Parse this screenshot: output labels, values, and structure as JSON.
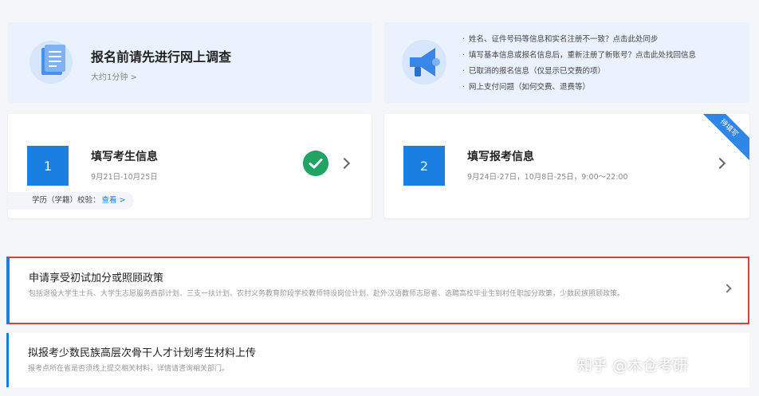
{
  "survey": {
    "title": "报名前请先进行网上调查",
    "subtitle": "大约1分钟 >"
  },
  "notice": {
    "items": [
      "姓名、证件号码等信息和实名注册不一致？点击此处同步",
      "填写基本信息或报名信息后，重新注册了新账号？点击此处找回信息",
      "已取消的报名信息（仅显示已交费的项）",
      "网上支付问题（如何交费、退费等）"
    ]
  },
  "step1": {
    "number": "1",
    "title": "填写考生信息",
    "date": "9月21日-10月25日",
    "verify_label": "学历（学籍）校验：",
    "verify_link": "查看 >"
  },
  "step2": {
    "number": "2",
    "title": "填写报考信息",
    "date": "9月24日-27日，10月8日-25日，9:00～22:00",
    "ribbon": "待填写"
  },
  "policy": {
    "title": "申请享受初试加分或照顾政策",
    "desc": "包括退役大学生士兵、大学生志愿服务西部计划、三支一扶计划、农村义务教育阶段学校教师特设岗位计划、赴外汉语教师志愿者、选聘高校毕业生到村任职加分政策，少数民族照顾政策。"
  },
  "minority": {
    "title": "拟报考少数民族高层次骨干人才计划考生材料上传",
    "desc": "报考点所在省是否须线上提交相关材料，详情请咨询相关部门。"
  },
  "watermark": "知乎 @木仓考研",
  "colors": {
    "primary": "#1a7fe0",
    "success": "#1fa464",
    "highlight_border": "#e03a3a",
    "banner_bg": "#eaf2fd"
  }
}
